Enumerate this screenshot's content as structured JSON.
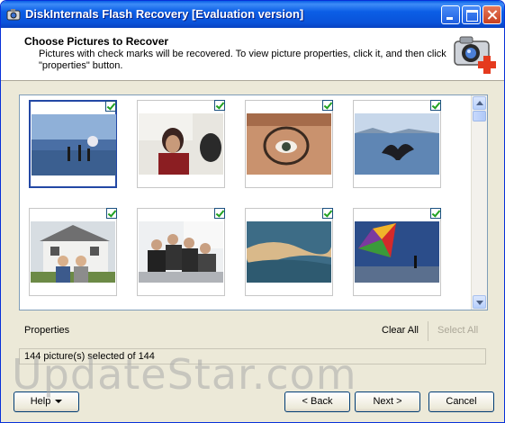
{
  "window": {
    "title": "DiskInternals Flash Recovery [Evaluation version]"
  },
  "header": {
    "title": "Choose Pictures to Recover",
    "subtitle": "Pictures with check marks will be recovered. To view picture properties, click it, and then click \"properties\" button."
  },
  "gallery": {
    "pictures": [
      {
        "name": "beach-kids",
        "checked": true,
        "selected": true
      },
      {
        "name": "presenter",
        "checked": true,
        "selected": false
      },
      {
        "name": "eye-glasses",
        "checked": true,
        "selected": false
      },
      {
        "name": "whale-tail",
        "checked": true,
        "selected": false
      },
      {
        "name": "couple-house",
        "checked": true,
        "selected": false
      },
      {
        "name": "meeting",
        "checked": true,
        "selected": false
      },
      {
        "name": "wave",
        "checked": true,
        "selected": false
      },
      {
        "name": "kite",
        "checked": true,
        "selected": false
      }
    ]
  },
  "actions": {
    "properties": "Properties",
    "clear_all": "Clear All",
    "select_all": "Select All"
  },
  "status": "144 picture(s) selected of 144",
  "buttons": {
    "help": "Help",
    "back": "< Back",
    "next": "Next >",
    "cancel": "Cancel"
  },
  "watermark": "UpdateStar.com",
  "colors": {
    "titlebar": "#0a5fe6",
    "check": "#21a121",
    "selection": "#2348a5"
  }
}
